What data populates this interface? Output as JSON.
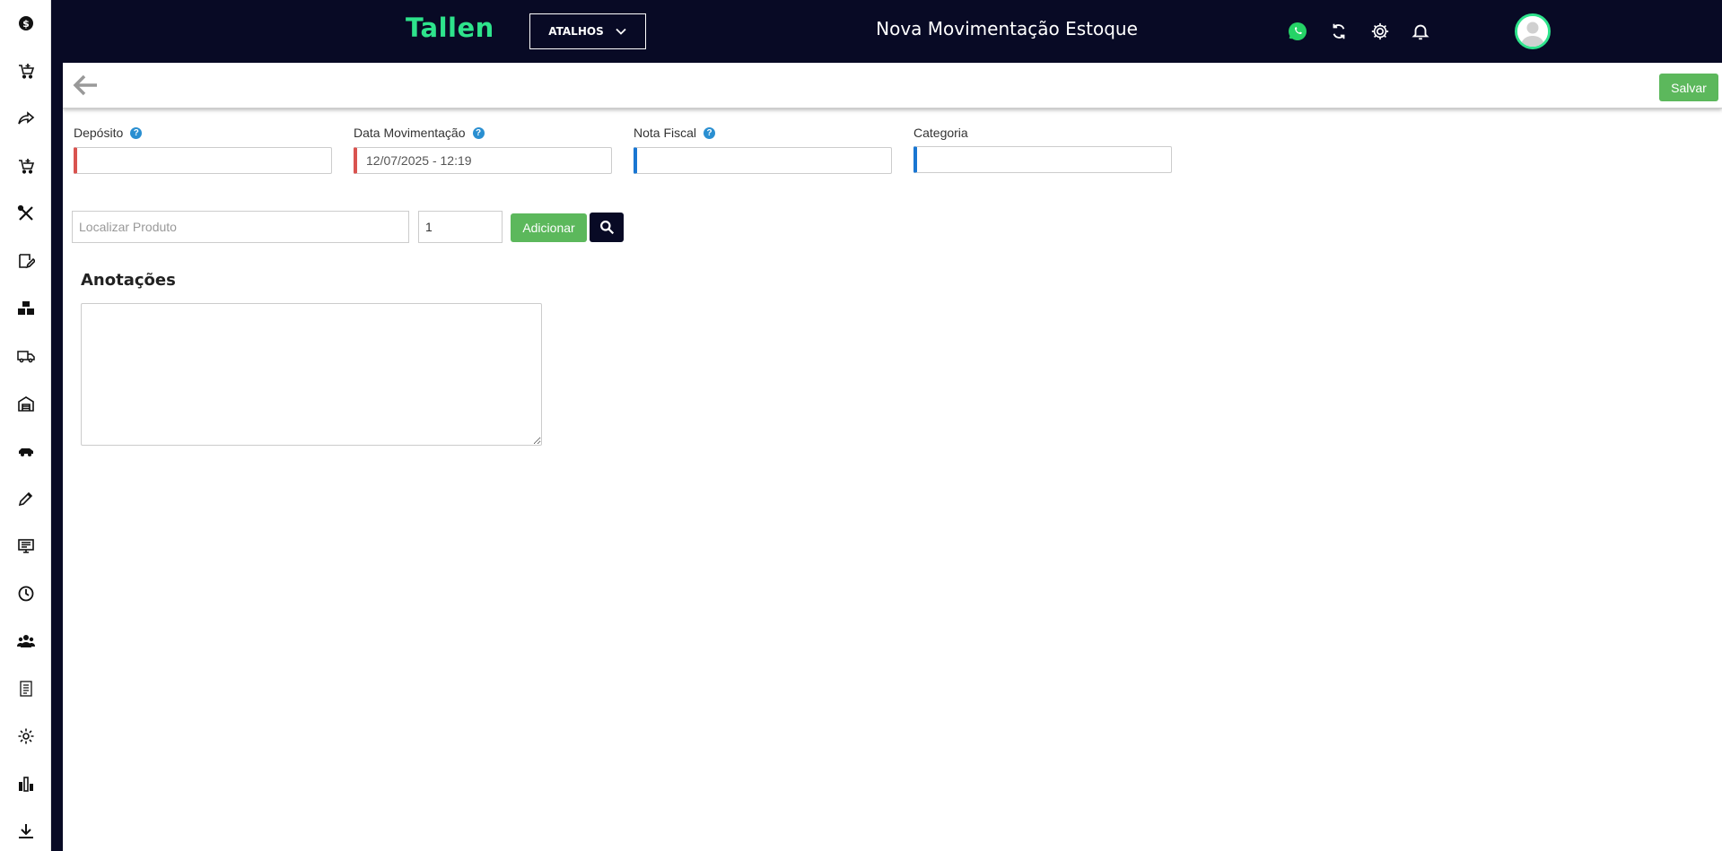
{
  "app": {
    "logo": "Tallen",
    "shortcuts_label": "ATALHOS",
    "page_title": "Nova Movimentação Estoque"
  },
  "sidebar": {
    "items": [
      {
        "icon": "dollar-icon"
      },
      {
        "icon": "cart-add-icon"
      },
      {
        "icon": "share-icon"
      },
      {
        "icon": "cart-add-icon"
      },
      {
        "icon": "tools-icon"
      },
      {
        "icon": "edit-note-icon"
      },
      {
        "icon": "boxes-icon"
      },
      {
        "icon": "truck-icon"
      },
      {
        "icon": "warehouse-icon"
      },
      {
        "icon": "car-icon"
      },
      {
        "icon": "pencil-icon"
      },
      {
        "icon": "monitor-icon"
      },
      {
        "icon": "clock-icon"
      },
      {
        "icon": "users-icon"
      },
      {
        "icon": "report-icon"
      },
      {
        "icon": "gear-icon"
      },
      {
        "icon": "bar-chart-icon"
      },
      {
        "icon": "download-icon"
      }
    ]
  },
  "toolbar": {
    "save_label": "Salvar"
  },
  "form": {
    "deposito": {
      "label": "Depósito",
      "value": ""
    },
    "data_movimentacao": {
      "label": "Data Movimentação",
      "value": "12/07/2025 - 12:19"
    },
    "nota_fiscal": {
      "label": "Nota Fiscal",
      "value": ""
    },
    "categoria": {
      "label": "Categoria",
      "value": ""
    },
    "help_glyph": "?"
  },
  "product": {
    "placeholder": "Localizar Produto",
    "quantity": "1",
    "add_label": "Adicionar"
  },
  "notes": {
    "title": "Anotações",
    "value": ""
  },
  "colors": {
    "navy": "#080a25",
    "brand_green": "#2ee38c",
    "button_green": "#5cb85c",
    "required_red": "#d9534f",
    "info_blue": "#1976d2"
  }
}
